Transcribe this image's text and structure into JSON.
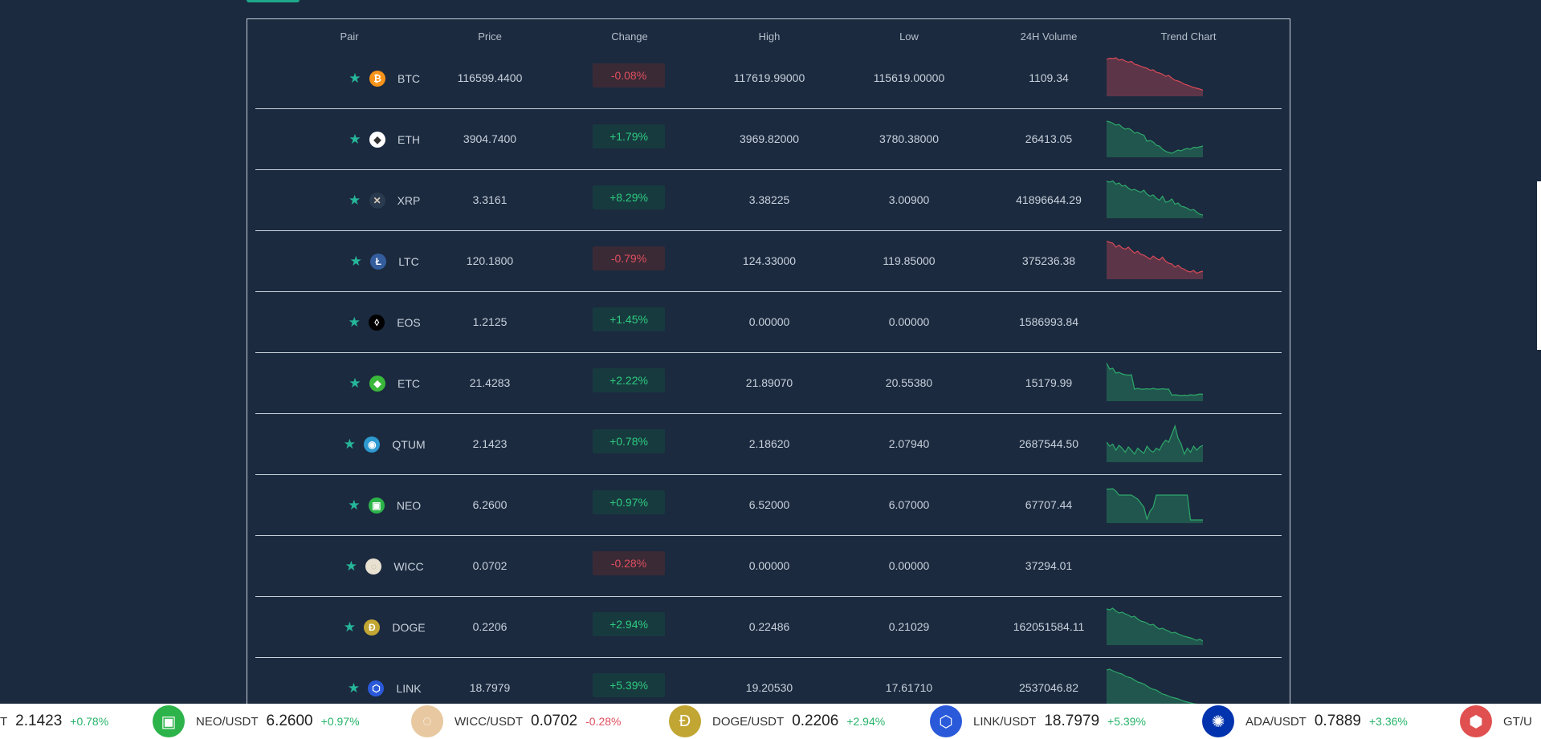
{
  "table": {
    "headers": {
      "pair": "Pair",
      "price": "Price",
      "change": "Change",
      "high": "High",
      "low": "Low",
      "volume": "24H Volume",
      "trend": "Trend Chart"
    },
    "rows": [
      {
        "symbol": "BTC",
        "icon": "bitcoin-icon",
        "icon_color": "#f7931a",
        "price": "116599.4400",
        "change": "-0.08%",
        "direction": "down",
        "high": "117619.99000",
        "low": "115619.00000",
        "volume": "1109.34",
        "trend": [
          92,
          95,
          94,
          96,
          90,
          92,
          88,
          85,
          87,
          80,
          78,
          75,
          72,
          70,
          65,
          66,
          60,
          58,
          55,
          50,
          52,
          45,
          40,
          38,
          35,
          30,
          28,
          25,
          22,
          20,
          18,
          15
        ]
      },
      {
        "symbol": "ETH",
        "icon": "ethereum-icon",
        "icon_color": "#ffffff",
        "price": "3904.7400",
        "change": "+1.79%",
        "direction": "up",
        "high": "3969.82000",
        "low": "3780.38000",
        "volume": "26413.05",
        "trend": [
          90,
          88,
          85,
          80,
          82,
          75,
          70,
          72,
          68,
          60,
          62,
          58,
          55,
          40,
          42,
          38,
          30,
          28,
          20,
          15,
          12,
          10,
          14,
          18,
          16,
          20,
          22,
          20,
          25,
          24,
          26,
          28
        ]
      },
      {
        "symbol": "XRP",
        "icon": "xrp-icon",
        "icon_color": "#2a3a4f",
        "price": "3.3161",
        "change": "+8.29%",
        "direction": "up",
        "high": "3.38225",
        "low": "3.00900",
        "volume": "41896644.29",
        "trend": [
          92,
          90,
          93,
          85,
          88,
          80,
          82,
          75,
          70,
          72,
          68,
          65,
          70,
          60,
          55,
          58,
          50,
          45,
          55,
          40,
          42,
          48,
          35,
          38,
          30,
          28,
          25,
          20,
          22,
          15,
          10,
          8
        ]
      },
      {
        "symbol": "LTC",
        "icon": "litecoin-icon",
        "icon_color": "#345d9d",
        "price": "120.1800",
        "change": "-0.79%",
        "direction": "down",
        "high": "124.33000",
        "low": "119.85000",
        "volume": "375236.38",
        "trend": [
          95,
          92,
          90,
          80,
          85,
          78,
          75,
          80,
          72,
          65,
          70,
          62,
          60,
          55,
          50,
          58,
          52,
          48,
          55,
          45,
          40,
          38,
          30,
          35,
          28,
          25,
          20,
          18,
          22,
          15,
          18,
          20
        ]
      },
      {
        "symbol": "EOS",
        "icon": "eos-icon",
        "icon_color": "#000000",
        "price": "1.2125",
        "change": "+1.45%",
        "direction": "up",
        "high": "0.00000",
        "low": "0.00000",
        "volume": "1586993.84",
        "trend": []
      },
      {
        "symbol": "ETC",
        "icon": "ethereum-classic-icon",
        "icon_color": "#3ab83a",
        "price": "21.4283",
        "change": "+2.22%",
        "direction": "up",
        "high": "21.89070",
        "low": "20.55380",
        "volume": "15179.99",
        "trend": [
          95,
          80,
          82,
          70,
          72,
          68,
          66,
          65,
          66,
          30,
          32,
          30,
          30,
          31,
          30,
          32,
          30,
          30,
          31,
          30,
          30,
          15,
          16,
          15,
          14,
          15,
          14,
          16,
          15,
          16,
          18,
          17
        ]
      },
      {
        "symbol": "QTUM",
        "icon": "qtum-icon",
        "icon_color": "#2e9ad0",
        "price": "2.1423",
        "change": "+0.78%",
        "direction": "up",
        "high": "2.18620",
        "low": "2.07940",
        "volume": "2687544.50",
        "trend": [
          50,
          40,
          45,
          30,
          42,
          35,
          25,
          38,
          30,
          20,
          35,
          28,
          22,
          40,
          30,
          25,
          35,
          30,
          45,
          55,
          50,
          70,
          90,
          60,
          45,
          20,
          35,
          25,
          40,
          30,
          38,
          42
        ]
      },
      {
        "symbol": "NEO",
        "icon": "neo-icon",
        "icon_color": "#2cb34a",
        "price": "6.2600",
        "change": "+0.97%",
        "direction": "up",
        "high": "6.52000",
        "low": "6.07000",
        "volume": "67707.44",
        "trend": [
          85,
          85,
          86,
          80,
          70,
          70,
          70,
          70,
          70,
          65,
          60,
          50,
          40,
          10,
          30,
          40,
          70,
          70,
          70,
          70,
          70,
          70,
          70,
          70,
          70,
          70,
          70,
          8,
          8,
          8,
          8,
          8
        ]
      },
      {
        "symbol": "WICC",
        "icon": "wicc-icon",
        "icon_color": "#e8e0d0",
        "price": "0.0702",
        "change": "-0.28%",
        "direction": "down",
        "high": "0.00000",
        "low": "0.00000",
        "volume": "37294.01",
        "trend": []
      },
      {
        "symbol": "DOGE",
        "icon": "dogecoin-icon",
        "icon_color": "#c2a633",
        "price": "0.2206",
        "change": "+2.94%",
        "direction": "up",
        "high": "0.22486",
        "low": "0.21029",
        "volume": "162051584.11",
        "trend": [
          90,
          88,
          92,
          85,
          80,
          82,
          78,
          75,
          70,
          72,
          65,
          60,
          58,
          55,
          50,
          52,
          45,
          40,
          42,
          38,
          35,
          30,
          32,
          28,
          25,
          22,
          20,
          18,
          15,
          12,
          15,
          10
        ]
      },
      {
        "symbol": "LINK",
        "icon": "chainlink-icon",
        "icon_color": "#2a5ada",
        "price": "18.7979",
        "change": "+5.39%",
        "direction": "up",
        "high": "19.20530",
        "low": "17.61710",
        "volume": "2537046.82",
        "trend": [
          90,
          92,
          88,
          85,
          82,
          80,
          75,
          72,
          70,
          65,
          60,
          58,
          55,
          50,
          45,
          42,
          40,
          35,
          30,
          28,
          25,
          22,
          20,
          18,
          15,
          12,
          10,
          8,
          6,
          5,
          4,
          3
        ]
      }
    ]
  },
  "ticker": [
    {
      "pair": "T",
      "price": "2.1423",
      "change": "+0.78%",
      "direction": "up",
      "icon": "qtum-icon",
      "color": "#2e9ad0"
    },
    {
      "pair": "NEO/USDT",
      "price": "6.2600",
      "change": "+0.97%",
      "direction": "up",
      "icon": "neo-icon",
      "color": "#2cb34a"
    },
    {
      "pair": "WICC/USDT",
      "price": "0.0702",
      "change": "-0.28%",
      "direction": "down",
      "icon": "wicc-icon",
      "color": "#e8c8a0"
    },
    {
      "pair": "DOGE/USDT",
      "price": "0.2206",
      "change": "+2.94%",
      "direction": "up",
      "icon": "dogecoin-icon",
      "color": "#c2a633"
    },
    {
      "pair": "LINK/USDT",
      "price": "18.7979",
      "change": "+5.39%",
      "direction": "up",
      "icon": "chainlink-icon",
      "color": "#2a5ada"
    },
    {
      "pair": "ADA/USDT",
      "price": "0.7889",
      "change": "+3.36%",
      "direction": "up",
      "icon": "cardano-icon",
      "color": "#0033ad"
    },
    {
      "pair": "GT/U",
      "price": "",
      "change": "",
      "direction": "up",
      "icon": "gatetoken-icon",
      "color": "#e05050"
    }
  ]
}
